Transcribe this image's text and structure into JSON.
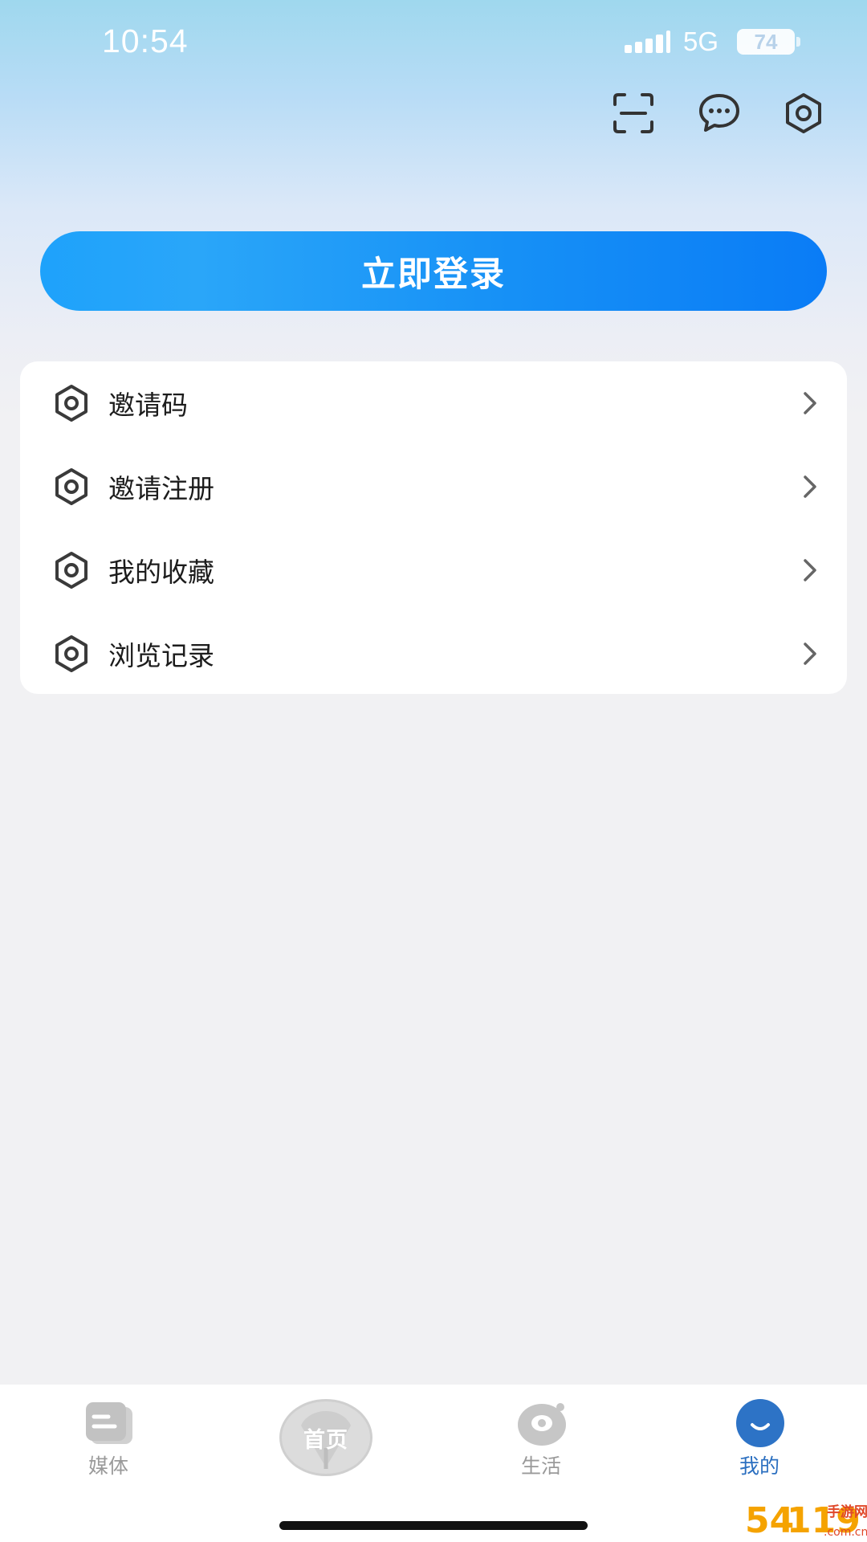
{
  "status_bar": {
    "time": "10:54",
    "network": "5G",
    "battery": "74"
  },
  "top_icons": [
    "scan-icon",
    "message-icon",
    "settings-icon"
  ],
  "login_button": {
    "label": "立即登录"
  },
  "menu": {
    "items": [
      {
        "label": "邀请码",
        "icon": "hexagon-icon"
      },
      {
        "label": "邀请注册",
        "icon": "hexagon-icon"
      },
      {
        "label": "我的收藏",
        "icon": "hexagon-icon"
      },
      {
        "label": "浏览记录",
        "icon": "hexagon-icon"
      }
    ]
  },
  "bottom_nav": {
    "items": [
      {
        "label": "媒体",
        "icon": "media-icon",
        "active": false
      },
      {
        "label": "首页",
        "icon": "home-badge",
        "active": false
      },
      {
        "label": "生活",
        "icon": "life-icon",
        "active": false
      },
      {
        "label": "我的",
        "icon": "profile-icon",
        "active": true
      }
    ]
  },
  "watermark": {
    "text": "54119手游网 .com.cn"
  },
  "colors": {
    "accent": "#1690f6",
    "active_tab": "#2b6fc0",
    "inactive_tab": "#9a9a9a",
    "page_background": "#f1f1f3"
  }
}
